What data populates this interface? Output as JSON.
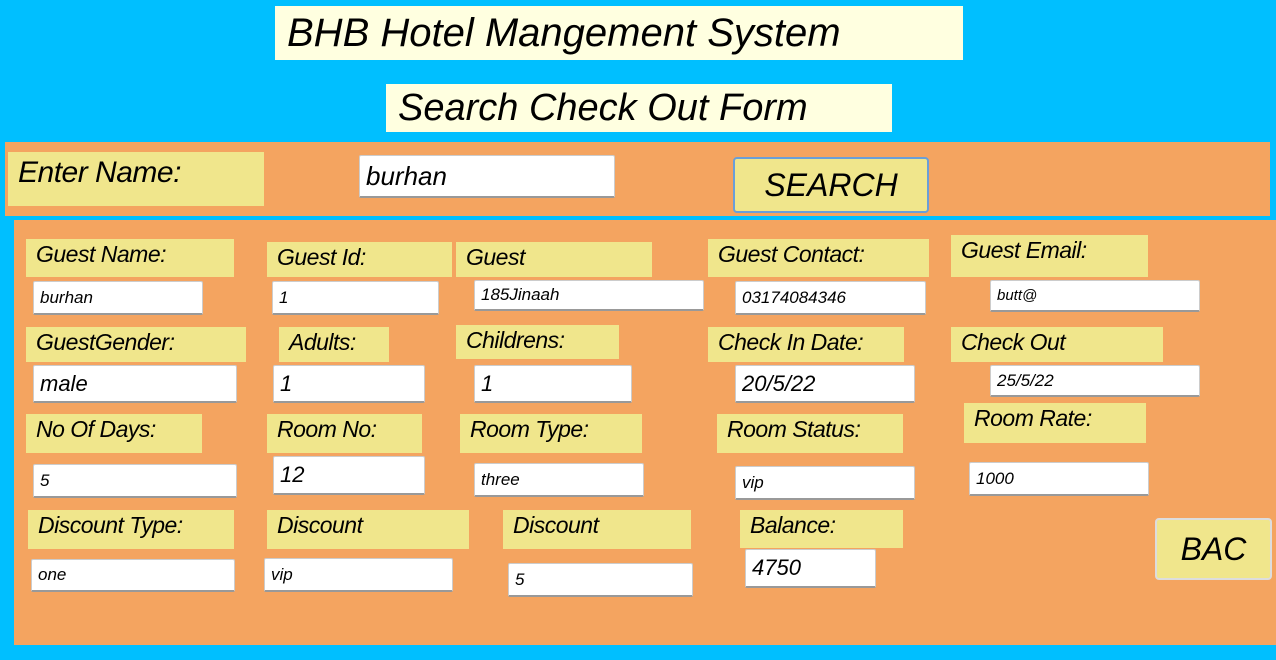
{
  "app_title": "BHB Hotel Mangement System",
  "form_title": "Search Check Out Form",
  "search": {
    "label": "Enter Name:",
    "value": "burhan",
    "button": "SEARCH"
  },
  "fields": {
    "guest_name": {
      "label": "Guest Name:",
      "value": "burhan"
    },
    "guest_id": {
      "label": "Guest Id:",
      "value": "1"
    },
    "guest_address": {
      "label": "Guest",
      "value": "185Jinaah"
    },
    "guest_contact": {
      "label": "Guest Contact:",
      "value": "03174084346"
    },
    "guest_email": {
      "label": "Guest Email:",
      "value": "butt@"
    },
    "guest_gender": {
      "label": "GuestGender:",
      "value": "male"
    },
    "adults": {
      "label": "Adults:",
      "value": "1"
    },
    "childrens": {
      "label": "Childrens:",
      "value": "1"
    },
    "check_in": {
      "label": "Check In Date:",
      "value": "20/5/22"
    },
    "check_out": {
      "label": "Check Out",
      "value": "25/5/22"
    },
    "no_of_days": {
      "label": "No Of Days:",
      "value": "5"
    },
    "room_no": {
      "label": "Room No:",
      "value": "12"
    },
    "room_type": {
      "label": "Room Type:",
      "value": "three"
    },
    "room_status": {
      "label": "Room Status:",
      "value": "vip"
    },
    "room_rate": {
      "label": "Room Rate:",
      "value": "1000"
    },
    "discount_type": {
      "label": "Discount Type:",
      "value": "one"
    },
    "discount": {
      "label": "Discount",
      "value": "vip"
    },
    "discount_amount": {
      "label": "Discount",
      "value": "5"
    },
    "balance": {
      "label": "Balance:",
      "value": "4750"
    }
  },
  "back_button": "BAC"
}
